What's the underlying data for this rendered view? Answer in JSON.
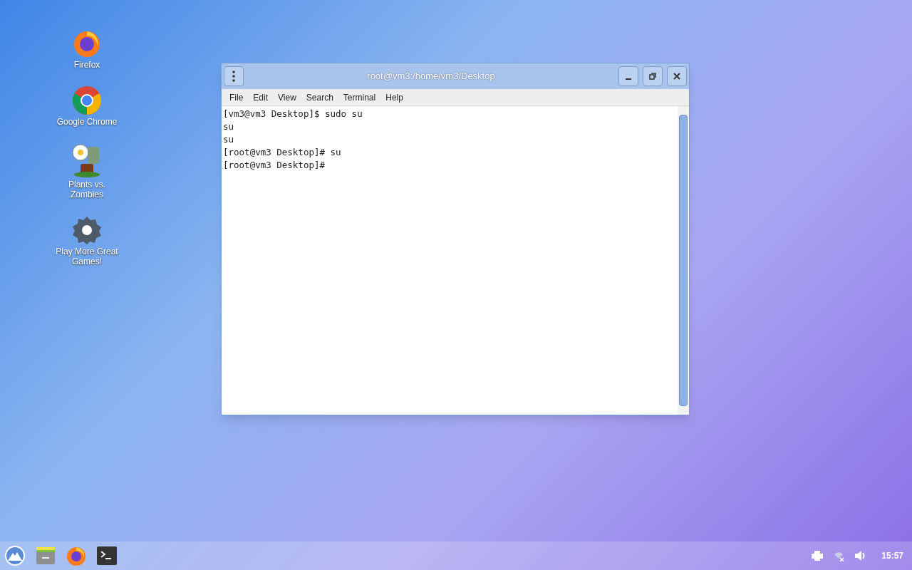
{
  "desktop_icons": [
    {
      "kind": "firefox",
      "label": "Firefox"
    },
    {
      "kind": "chrome",
      "label": "Google Chrome"
    },
    {
      "kind": "game",
      "label": "Plants vs. Zombies"
    },
    {
      "kind": "gear",
      "label": "Play More Great Games!"
    }
  ],
  "window": {
    "title": "root@vm3:/home/vm3/Desktop",
    "menu": [
      "File",
      "Edit",
      "View",
      "Search",
      "Terminal",
      "Help"
    ],
    "lines": [
      "[vm3@vm3 Desktop]$ sudo su",
      "su",
      "su",
      "[root@vm3 Desktop]# su",
      "[root@vm3 Desktop]#"
    ]
  },
  "taskbar": {
    "clock": "15:57"
  }
}
